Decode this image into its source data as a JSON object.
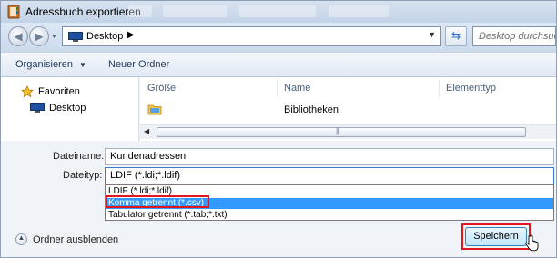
{
  "window": {
    "title": "Adressbuch exportieren"
  },
  "address_bar": {
    "location": "Desktop",
    "search_placeholder": "Desktop durchsuchen"
  },
  "toolbar": {
    "organize_label": "Organisieren",
    "new_folder_label": "Neuer Ordner"
  },
  "nav_pane": {
    "items": [
      {
        "label": "Favoriten",
        "icon": "star-icon"
      },
      {
        "label": "Desktop",
        "icon": "desktop-icon"
      }
    ]
  },
  "file_list": {
    "columns": [
      "Größe",
      "Name",
      "Elementtyp"
    ],
    "rows": [
      {
        "name": "Bibliotheken",
        "icon": "library-folder-icon"
      }
    ]
  },
  "form": {
    "filename_label": "Dateiname:",
    "filename_value": "Kundenadressen",
    "filetype_label": "Dateityp:",
    "filetype_value": "LDIF (*.ldi;*.ldif)",
    "filetype_options": [
      {
        "label": "LDIF (*.ldi;*.ldif)",
        "selected": false
      },
      {
        "label": "Komma getrennt (*.csv)",
        "selected": true
      },
      {
        "label": "Tabulator getrennt (*.tab;*.txt)",
        "selected": false
      }
    ]
  },
  "footer": {
    "hide_folders_label": "Ordner ausblenden",
    "save_label": "Speichern"
  },
  "colors": {
    "highlight": "#e0171d",
    "selection": "#3399ff",
    "accent": "#3d7bc8"
  }
}
